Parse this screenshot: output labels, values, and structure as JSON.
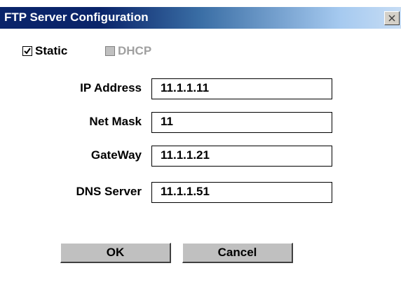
{
  "window": {
    "title": "FTP Server Configuration",
    "close_icon": "close-x-icon",
    "title_bar_color": "#0a246a"
  },
  "mode": {
    "static": {
      "label": "Static",
      "checked": true
    },
    "dhcp": {
      "label": "DHCP",
      "checked": false,
      "disabled": true
    }
  },
  "fields": {
    "ip_address": {
      "label": "IP Address",
      "value": "11.1.1.11"
    },
    "net_mask": {
      "label": "Net Mask",
      "value": "11"
    },
    "gateway": {
      "label": "GateWay",
      "value": "11.1.1.21"
    },
    "dns_server": {
      "label": "DNS Server",
      "value": "11.1.1.51"
    }
  },
  "buttons": {
    "ok_label": "OK",
    "cancel_label": "Cancel"
  }
}
